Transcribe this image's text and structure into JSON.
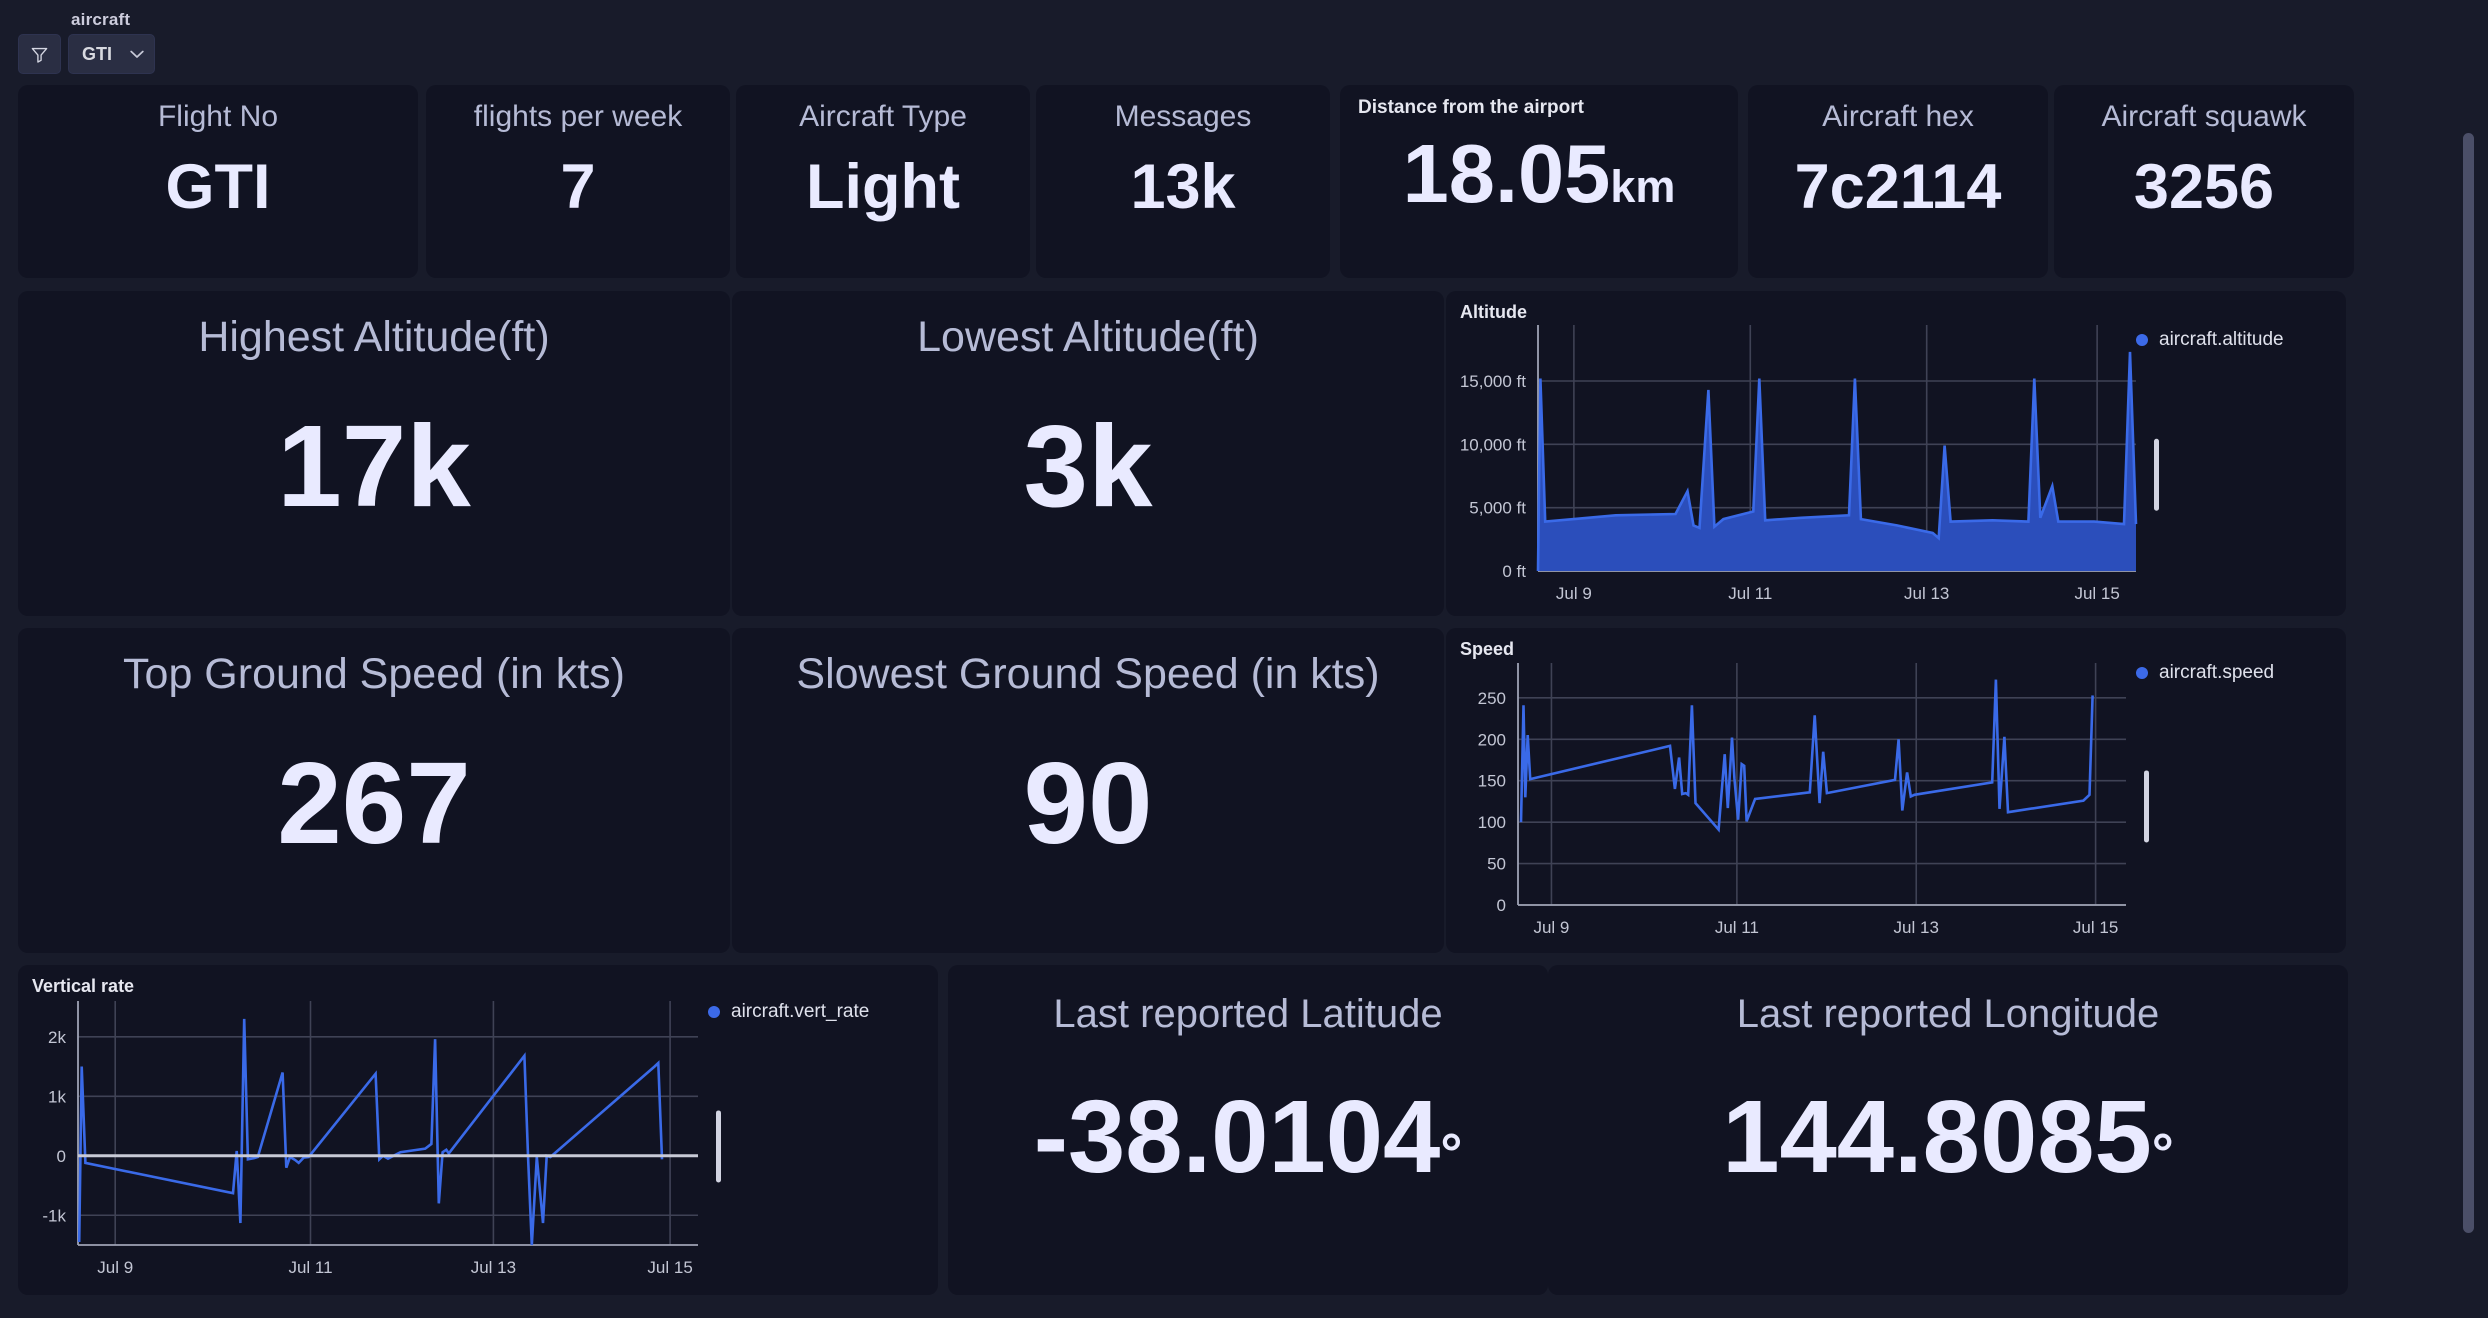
{
  "variables": {
    "label": "aircraft",
    "filter_icon": "filter-icon",
    "selected_value": "GTI",
    "chevron_icon": "chevron-down-icon"
  },
  "stats": {
    "flight_no": {
      "title": "Flight No",
      "value": "GTI"
    },
    "flights_week": {
      "title": "flights per week",
      "value": "7"
    },
    "aircraft_type": {
      "title": "Aircraft Type",
      "value": "Light"
    },
    "messages": {
      "title": "Messages",
      "value": "13k"
    },
    "distance": {
      "title": "Distance from the airport",
      "value": "18.05",
      "unit": "km"
    },
    "aircraft_hex": {
      "title": "Aircraft hex",
      "value": "7c2114"
    },
    "aircraft_squawk": {
      "title": "Aircraft squawk",
      "value": "3256"
    },
    "highest_alt": {
      "title": "Highest Altitude(ft)",
      "value": "17k"
    },
    "lowest_alt": {
      "title": "Lowest Altitude(ft)",
      "value": "3k"
    },
    "top_speed": {
      "title": "Top Ground Speed (in kts)",
      "value": "267"
    },
    "slow_speed": {
      "title": "Slowest Ground Speed (in kts)",
      "value": "90"
    },
    "latitude": {
      "title": "Last reported Latitude",
      "value": "-38.0104",
      "unit": "°"
    },
    "longitude": {
      "title": "Last reported Longitude",
      "value": "144.8085",
      "unit": "°"
    }
  },
  "chart_data": [
    {
      "id": "altitude",
      "type": "area",
      "title": "Altitude",
      "legend": [
        "aircraft.altitude"
      ],
      "legend_position": "right",
      "color": "#2b4ebb",
      "line_color": "#3a6ae8",
      "xlabel": "",
      "ylabel": "",
      "x_ticks": [
        "Jul 9",
        "Jul 11",
        "Jul 13",
        "Jul 15"
      ],
      "y_ticks": [
        "0 ft",
        "5,000 ft",
        "10,000 ft",
        "15,000 ft"
      ],
      "ylim": [
        0,
        18000
      ],
      "grid": true,
      "series": [
        {
          "name": "aircraft.altitude",
          "points": [
            [
              0.0,
              0
            ],
            [
              0.4,
              15200
            ],
            [
              1.2,
              3900
            ],
            [
              6.0,
              4100
            ],
            [
              13.0,
              4400
            ],
            [
              23.0,
              4500
            ],
            [
              25.0,
              6300
            ],
            [
              26.0,
              3600
            ],
            [
              27.0,
              3400
            ],
            [
              28.5,
              14300
            ],
            [
              29.5,
              3500
            ],
            [
              31.0,
              4100
            ],
            [
              36.0,
              4700
            ],
            [
              37.0,
              15200
            ],
            [
              38.0,
              4000
            ],
            [
              44.0,
              4200
            ],
            [
              52.0,
              4400
            ],
            [
              53.0,
              15200
            ],
            [
              54.0,
              4100
            ],
            [
              60.0,
              3600
            ],
            [
              66.0,
              3000
            ],
            [
              67.0,
              2600
            ],
            [
              68.0,
              9900
            ],
            [
              69.0,
              3900
            ],
            [
              76.0,
              4000
            ],
            [
              82.0,
              3900
            ],
            [
              83.0,
              15200
            ],
            [
              84.0,
              4200
            ],
            [
              86.0,
              6700
            ],
            [
              87.0,
              3900
            ],
            [
              93.0,
              3900
            ],
            [
              98.0,
              3700
            ],
            [
              99.0,
              17300
            ],
            [
              100.0,
              3700
            ]
          ]
        }
      ]
    },
    {
      "id": "speed",
      "type": "line",
      "title": "Speed",
      "legend": [
        "aircraft.speed"
      ],
      "legend_position": "right",
      "color": "#3a6ae8",
      "xlabel": "",
      "ylabel": "",
      "x_ticks": [
        "Jul 9",
        "Jul 11",
        "Jul 13",
        "Jul 15"
      ],
      "y_ticks": [
        "0",
        "50",
        "100",
        "150",
        "200",
        "250"
      ],
      "ylim": [
        0,
        280
      ],
      "grid": true,
      "series": [
        {
          "name": "aircraft.speed",
          "points": [
            [
              0.5,
              100
            ],
            [
              0.9,
              241
            ],
            [
              1.2,
              130
            ],
            [
              1.6,
              205
            ],
            [
              2.0,
              152
            ],
            [
              25.0,
              192
            ],
            [
              25.8,
              140
            ],
            [
              26.5,
              178
            ],
            [
              27.0,
              134
            ],
            [
              27.6,
              135
            ],
            [
              28.0,
              133
            ],
            [
              28.6,
              241
            ],
            [
              29.2,
              123
            ],
            [
              33.0,
              91
            ],
            [
              34.0,
              182
            ],
            [
              34.5,
              117
            ],
            [
              35.2,
              202
            ],
            [
              35.6,
              153
            ],
            [
              36.2,
              103
            ],
            [
              36.8,
              170
            ],
            [
              37.2,
              168
            ],
            [
              37.6,
              101
            ],
            [
              39.0,
              128
            ],
            [
              48.0,
              136
            ],
            [
              48.8,
              229
            ],
            [
              49.6,
              123
            ],
            [
              50.2,
              185
            ],
            [
              50.8,
              135
            ],
            [
              62.0,
              151
            ],
            [
              62.6,
              200
            ],
            [
              63.2,
              114
            ],
            [
              64.0,
              160
            ],
            [
              64.6,
              131
            ],
            [
              65.2,
              133
            ],
            [
              78.0,
              148
            ],
            [
              78.6,
              272
            ],
            [
              79.2,
              116
            ],
            [
              80.0,
              203
            ],
            [
              80.6,
              112
            ],
            [
              93.0,
              126
            ],
            [
              94.0,
              133
            ],
            [
              94.5,
              253
            ]
          ]
        }
      ]
    },
    {
      "id": "vert_rate",
      "type": "line",
      "title": "Vertical rate",
      "legend": [
        "aircraft.vert_rate"
      ],
      "legend_position": "right",
      "color": "#3a6ae8",
      "xlabel": "",
      "ylabel": "",
      "x_ticks": [
        "Jul 9",
        "Jul 11",
        "Jul 13",
        "Jul 15"
      ],
      "y_ticks": [
        "-1k",
        "0",
        "1k",
        "2k"
      ],
      "ylim": [
        -1500,
        2400
      ],
      "grid": true,
      "zero_line": true,
      "series": [
        {
          "name": "aircraft.vert_rate",
          "points": [
            [
              0.2,
              -1450
            ],
            [
              0.6,
              1500
            ],
            [
              1.2,
              -120
            ],
            [
              25.0,
              -630
            ],
            [
              25.6,
              80
            ],
            [
              26.2,
              -1130
            ],
            [
              26.8,
              2300
            ],
            [
              27.4,
              -60
            ],
            [
              28.4,
              -40
            ],
            [
              29.0,
              -20
            ],
            [
              33.0,
              1400
            ],
            [
              33.6,
              -200
            ],
            [
              34.2,
              -20
            ],
            [
              35.0,
              -70
            ],
            [
              35.6,
              -120
            ],
            [
              36.4,
              -30
            ],
            [
              37.2,
              -20
            ],
            [
              48.0,
              1380
            ],
            [
              48.6,
              -60
            ],
            [
              49.2,
              0
            ],
            [
              50.0,
              -50
            ],
            [
              52.0,
              60
            ],
            [
              56.0,
              120
            ],
            [
              57.0,
              200
            ],
            [
              57.6,
              1960
            ],
            [
              58.2,
              -800
            ],
            [
              58.8,
              60
            ],
            [
              59.4,
              100
            ],
            [
              59.8,
              40
            ],
            [
              72.0,
              1680
            ],
            [
              72.6,
              -40
            ],
            [
              73.2,
              -1500
            ],
            [
              74.0,
              -20
            ],
            [
              75.0,
              -1130
            ],
            [
              75.6,
              0
            ],
            [
              76.2,
              -20
            ],
            [
              93.0,
              1500
            ],
            [
              93.6,
              1560
            ],
            [
              94.2,
              -60
            ]
          ]
        }
      ]
    }
  ]
}
